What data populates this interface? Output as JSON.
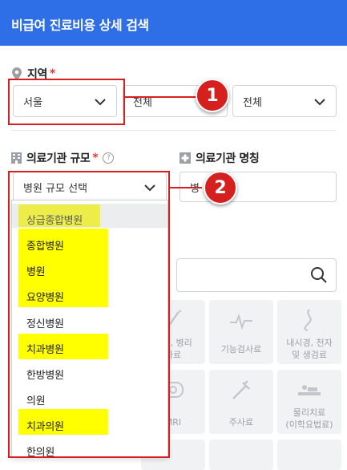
{
  "header": {
    "title": "비급여 진료비용 상세 검색"
  },
  "region": {
    "label": "지역",
    "required_mark": "*",
    "city_value": "서울",
    "district_value": "전체",
    "town_value": "전체"
  },
  "facility_scale": {
    "label": "의료기관 규모",
    "required_mark": "*",
    "help": "?",
    "placeholder": "병원 규모 선택",
    "options": [
      "상급종합병원",
      "종합병원",
      "병원",
      "요양병원",
      "정신병원",
      "치과병원",
      "한방병원",
      "의원",
      "치과의원",
      "한의원"
    ],
    "highlighted": [
      "상급종합병원",
      "종합병원",
      "병원",
      "요양병원",
      "치과병원",
      "치과의원"
    ]
  },
  "facility_name": {
    "label": "의료기관 명칭",
    "input_partial": "병"
  },
  "callouts": {
    "one": "1",
    "two": "2"
  },
  "categories": [
    {
      "line1": "처치, 병리",
      "line2": "사료"
    },
    {
      "line1": "기능검사료",
      "line2": ""
    },
    {
      "line1": "내시경, 천자",
      "line2": "및 생검료"
    },
    {
      "line1": "MRI",
      "line2": ""
    },
    {
      "line1": "주사료",
      "line2": ""
    },
    {
      "line1": "물리치료",
      "line2": "(이학요법료)"
    }
  ],
  "colors": {
    "brand": "#2e6ee6",
    "callout": "#d62020",
    "highlight": "#ffff00"
  }
}
